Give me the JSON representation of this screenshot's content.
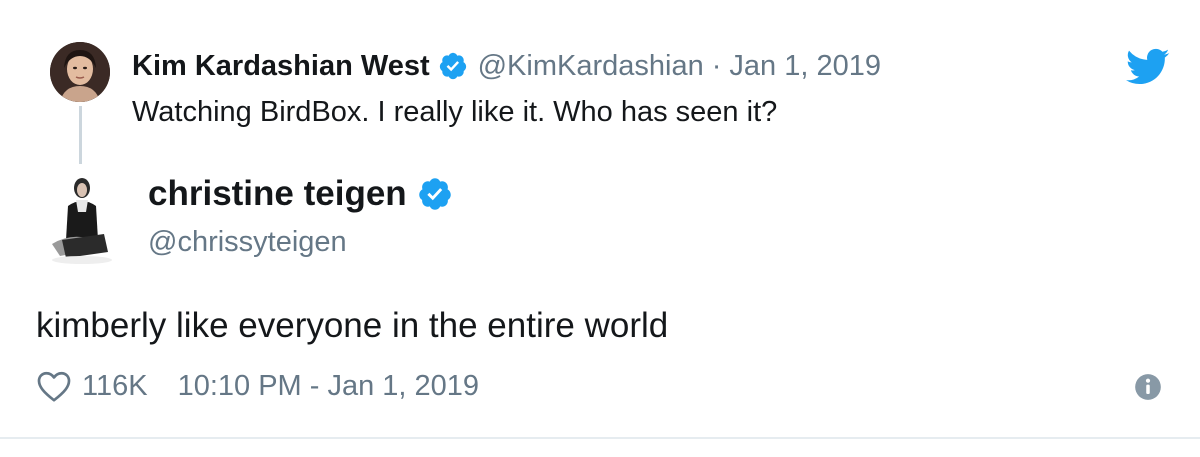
{
  "parent_tweet": {
    "author_name": "Kim Kardashian West",
    "handle": "@KimKardashian",
    "separator": "·",
    "date": "Jan 1, 2019",
    "text": "Watching BirdBox. I really like it. Who has seen it?",
    "verified_icon": "verified-badge-icon",
    "avatar_icon": "avatar"
  },
  "reply_tweet": {
    "author_name": "christine teigen",
    "handle": "@chrissyteigen",
    "text": "kimberly like everyone in the entire world",
    "likes": "116K",
    "timestamp": "10:10 PM - Jan 1, 2019",
    "verified_icon": "verified-badge-icon"
  },
  "icons": {
    "brand": "twitter-bird-icon",
    "like": "heart-icon",
    "info": "info-icon"
  },
  "colors": {
    "brand_blue": "#1da1f2",
    "text_primary": "#14171a",
    "text_secondary": "#657786",
    "thread_line": "#ccd6dd",
    "divider": "#e6ecf0"
  }
}
